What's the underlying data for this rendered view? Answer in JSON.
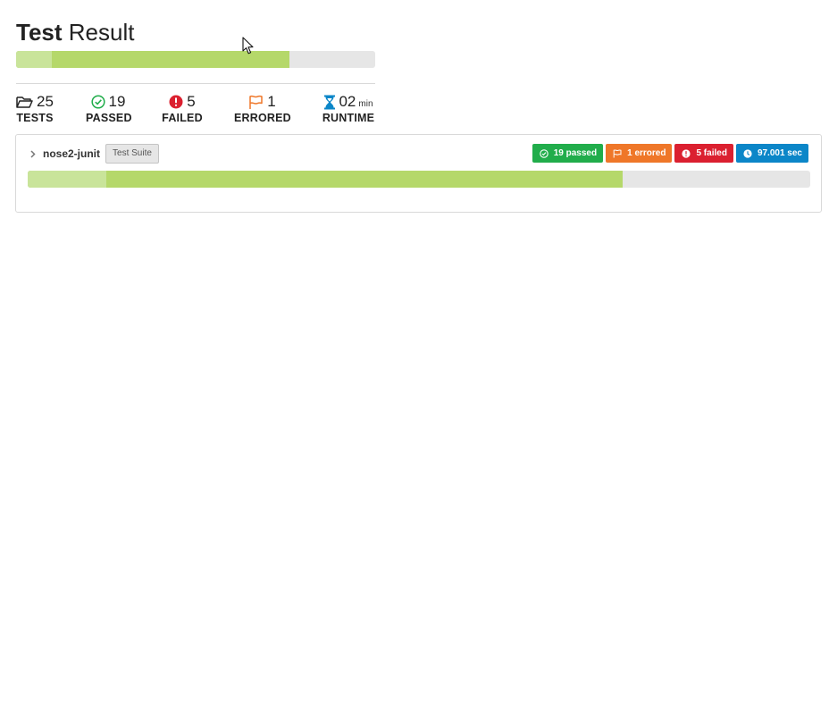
{
  "header": {
    "title_bold": "Test",
    "title_light": "Result"
  },
  "summary_progress": {
    "skipped_fraction": 0.1,
    "passed_fraction": 0.76,
    "colors": {
      "track": "#e6e6e6",
      "light": "#c9e49a",
      "green": "#b5d86a"
    }
  },
  "stats": {
    "tests": {
      "value": "25",
      "label": "TESTS",
      "icon": "folder-open-icon"
    },
    "passed": {
      "value": "19",
      "label": "PASSED",
      "icon": "check-circle-icon",
      "color": "#21ad4b"
    },
    "failed": {
      "value": "5",
      "label": "FAILED",
      "icon": "exclamation-circle-icon",
      "color": "#db2030"
    },
    "errored": {
      "value": "1",
      "label": "ERRORED",
      "icon": "flag-icon",
      "color": "#ef7729"
    },
    "runtime": {
      "value": "02",
      "unit": "min",
      "label": "RUNTIME",
      "icon": "hourglass-icon",
      "color": "#0b86c8"
    }
  },
  "suite": {
    "name": "nose2-junit",
    "tag": "Test Suite",
    "badges": {
      "passed": "19 passed",
      "errored": "1 errored",
      "failed": "5 failed",
      "time": "97.001 sec"
    },
    "progress": {
      "skipped_fraction": 0.1,
      "passed_fraction": 0.76
    }
  }
}
